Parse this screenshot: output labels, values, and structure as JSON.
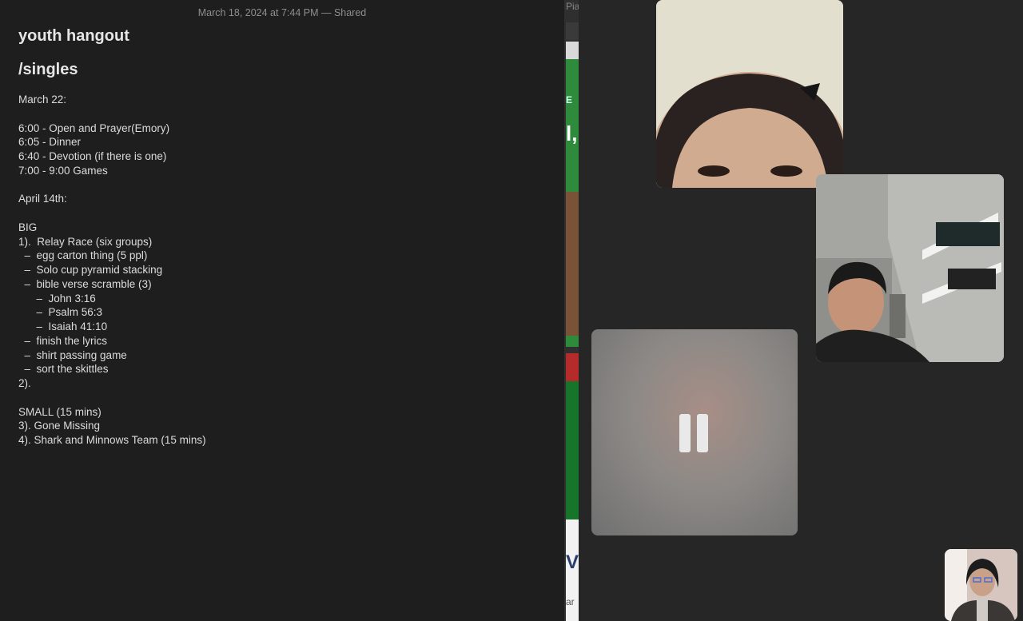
{
  "note": {
    "meta": "March 18, 2024 at 7:44 PM — Shared",
    "title_line1": "youth hangout",
    "title_line2": "/singles",
    "lines": [
      "March 22:",
      "",
      "6:00 - Open and Prayer(Emory)",
      "6:05 - Dinner",
      "6:40 - Devotion (if there is one)",
      "7:00 - 9:00 Games",
      "",
      "April 14th:",
      "",
      "BIG",
      "1).  Relay Race (six groups)",
      "  –  egg carton thing (5 ppl)",
      "  –  Solo cup pyramid stacking",
      "  –  bible verse scramble (3)",
      "      –  John 3:16",
      "      –  Psalm 56:3",
      "      –  Isaiah 41:10",
      "  –  finish the lyrics",
      "  –  shirt passing game",
      "  –  sort the skittles",
      "2).",
      "",
      "SMALL (15 mins)",
      "3). Gone Missing",
      "4). Shark and Minnows Team (15 mins)"
    ]
  },
  "background_window": {
    "top_text": "Piar",
    "mid_text": "E",
    "mid_text2": "l,",
    "bottom_text": "V",
    "bottom_text2": "ar"
  },
  "facetime": {
    "participants": [
      {
        "name": "participant-1",
        "state": "video"
      },
      {
        "name": "participant-2",
        "state": "video"
      },
      {
        "name": "participant-3",
        "state": "paused"
      }
    ],
    "paused_icon": "pause-icon",
    "self_view": "self-view"
  }
}
